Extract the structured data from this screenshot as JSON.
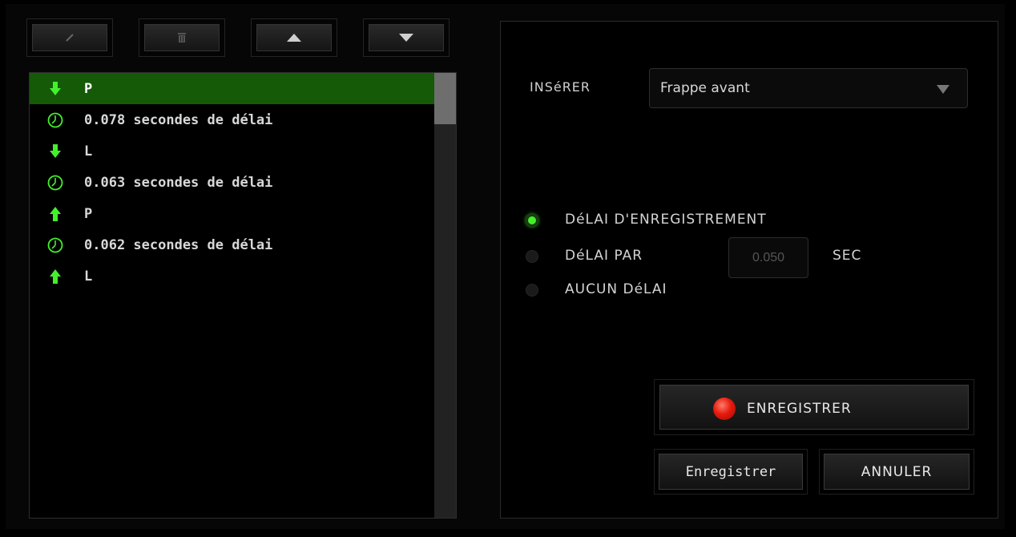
{
  "toolbar": {
    "edit_icon": "pencil-icon",
    "delete_icon": "trash-icon",
    "up_icon": "arrow-up-icon",
    "down_icon": "arrow-down-icon"
  },
  "macro_list": {
    "items": [
      {
        "type": "key-down",
        "icon": "arrow-down-icon",
        "label": "P",
        "selected": true
      },
      {
        "type": "delay",
        "icon": "clock-icon",
        "label": "0.078 secondes de délai",
        "selected": false
      },
      {
        "type": "key-down",
        "icon": "arrow-down-icon",
        "label": "L",
        "selected": false
      },
      {
        "type": "delay",
        "icon": "clock-icon",
        "label": "0.063 secondes de délai",
        "selected": false
      },
      {
        "type": "key-up",
        "icon": "arrow-up-icon",
        "label": "P",
        "selected": false
      },
      {
        "type": "delay",
        "icon": "clock-icon",
        "label": "0.062 secondes de délai",
        "selected": false
      },
      {
        "type": "key-up",
        "icon": "arrow-up-icon",
        "label": "L",
        "selected": false
      }
    ]
  },
  "insert": {
    "label": "INSéRER",
    "selected_option": "Frappe avant"
  },
  "delay_options": {
    "record_delay_label": "DéLAI D'ENREGISTREMENT",
    "fixed_delay_label": "DéLAI PAR",
    "no_delay_label": "AUCUN DéLAI",
    "fixed_delay_value": "0.050",
    "sec_label": "SEC",
    "selected": "record_delay"
  },
  "buttons": {
    "record_label": "ENREGISTRER",
    "save_label": "Enregistrer",
    "cancel_label": "ANNULER"
  },
  "colors": {
    "accent_green": "#43f02a",
    "selection_green": "#145a07",
    "record_red": "#e51b0e"
  }
}
